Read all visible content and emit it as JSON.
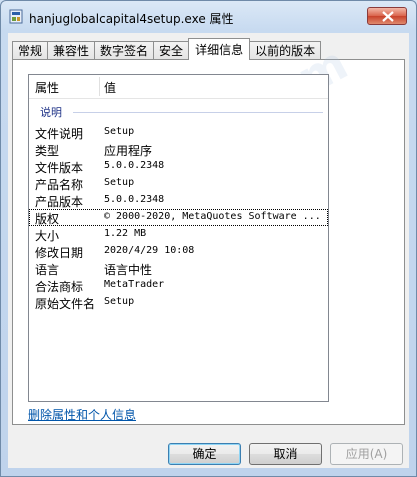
{
  "window": {
    "title": "hanjuglobalcapital4setup.exe 属性"
  },
  "tabs": [
    "常规",
    "兼容性",
    "数字签名",
    "安全",
    "详细信息",
    "以前的版本"
  ],
  "list": {
    "header": {
      "name": "属性",
      "value": "值"
    },
    "group": "说明",
    "rows": [
      {
        "name": "文件说明",
        "value": "Setup"
      },
      {
        "name": "类型",
        "value": "应用程序"
      },
      {
        "name": "文件版本",
        "value": "5.0.0.2348"
      },
      {
        "name": "产品名称",
        "value": "Setup"
      },
      {
        "name": "产品版本",
        "value": "5.0.0.2348"
      },
      {
        "name": "版权",
        "value": "© 2000-2020, MetaQuotes Software ..."
      },
      {
        "name": "大小",
        "value": "1.22 MB"
      },
      {
        "name": "修改日期",
        "value": "2020/4/29 10:08"
      },
      {
        "name": "语言",
        "value": "语言中性"
      },
      {
        "name": "合法商标",
        "value": "MetaTrader"
      },
      {
        "name": "原始文件名",
        "value": "Setup"
      }
    ]
  },
  "remove_link": "删除属性和个人信息",
  "buttons": {
    "ok": "确定",
    "cancel": "取消",
    "apply": "应用(A)"
  },
  "watermark": "FX110.com",
  "icons": {
    "app": "setup-exe-icon",
    "close": "close-icon"
  }
}
